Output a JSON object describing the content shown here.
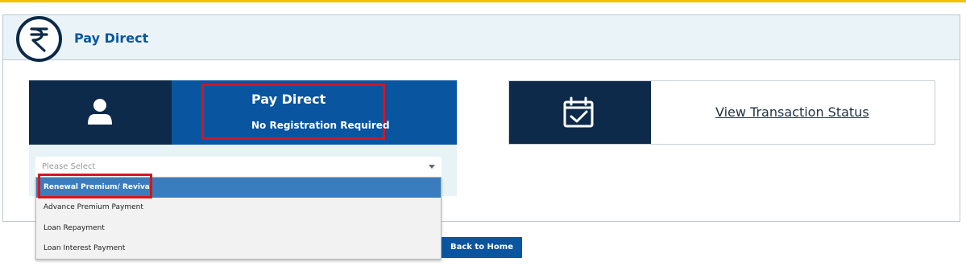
{
  "header": {
    "title": "Pay Direct",
    "icon": "rupee-icon"
  },
  "pay_card": {
    "title": "Pay Direct",
    "subtitle": "No Registration Required",
    "icon": "user-icon"
  },
  "status_card": {
    "link_label": "View Transaction Status",
    "icon": "calendar-check-icon"
  },
  "select": {
    "placeholder": "Please Select",
    "options": [
      "Renewal Premium/ Revival",
      "Advance Premium Payment",
      "Loan Repayment",
      "Loan Interest Payment"
    ],
    "highlighted_index": 0
  },
  "back_button": {
    "label": "Back to Home"
  },
  "colors": {
    "navy": "#0d2a4a",
    "blue": "#0a55a0",
    "highlight_red": "#d7141e",
    "top_accent": "#f2c200"
  }
}
